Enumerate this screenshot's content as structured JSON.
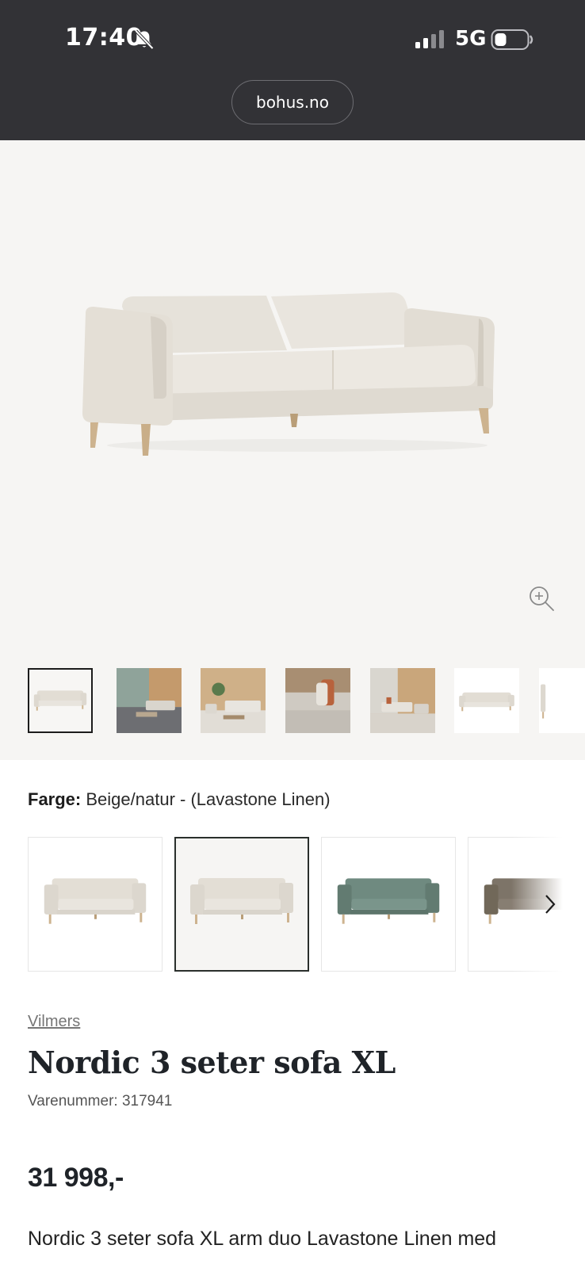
{
  "status_bar": {
    "time": "17:40",
    "network": "5G",
    "icons": [
      "bell-slash-icon",
      "signal-icon",
      "battery-icon"
    ]
  },
  "browser": {
    "url": "bohus.no"
  },
  "gallery": {
    "thumbnail_count": 7,
    "selected_index": 0,
    "zoom_icon": "zoom-in-icon"
  },
  "color": {
    "label": "Farge:",
    "value": "Beige/natur - (Lavastone Linen)",
    "swatches": [
      {
        "name": "beige-light",
        "color": "#e3ded5"
      },
      {
        "name": "beige-natur",
        "color": "#e3ded5",
        "selected": true
      },
      {
        "name": "green",
        "color": "#6f8a80"
      },
      {
        "name": "brown",
        "color": "#7d7468"
      }
    ]
  },
  "product": {
    "brand": "Vilmers",
    "title": "Nordic 3 seter sofa XL",
    "sku": "Varenummer: 317941",
    "price": "31 998,-",
    "description": "Nordic 3 seter sofa XL arm duo Lavastone Linen med"
  },
  "colors": {
    "topbar_bg": "#323236",
    "gallery_bg": "#f6f5f3",
    "sofa_fabric": "#e3ded5",
    "wood_legs": "#cdb38f"
  }
}
